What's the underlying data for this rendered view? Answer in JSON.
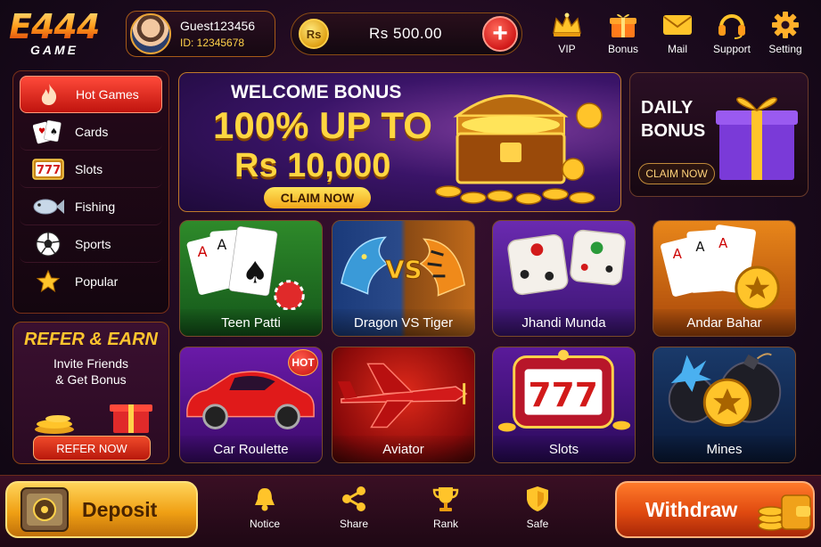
{
  "logo": {
    "main": "E444",
    "sub": "GAME"
  },
  "profile": {
    "name": "Guest123456",
    "id": "ID: 12345678"
  },
  "balance": {
    "currency_icon": "Rs",
    "amount": "Rs  500.00"
  },
  "top_icons": [
    {
      "label": "VIP",
      "icon": "crown-icon"
    },
    {
      "label": "Bonus",
      "icon": "gift-icon"
    },
    {
      "label": "Mail",
      "icon": "mail-icon"
    },
    {
      "label": "Support",
      "icon": "headset-icon"
    },
    {
      "label": "Setting",
      "icon": "gear-icon"
    }
  ],
  "sidebar": {
    "items": [
      {
        "label": "Hot Games",
        "icon": "flame-icon",
        "active": true
      },
      {
        "label": "Cards",
        "icon": "playing-cards-icon"
      },
      {
        "label": "Slots",
        "icon": "slot-777-icon"
      },
      {
        "label": "Fishing",
        "icon": "fish-icon"
      },
      {
        "label": "Sports",
        "icon": "soccer-ball-icon"
      },
      {
        "label": "Popular",
        "icon": "star-icon"
      }
    ]
  },
  "refer": {
    "title": "REFER & EARN",
    "line1": "Invite Friends",
    "line2": "& Get Bonus",
    "button": "REFER NOW"
  },
  "welcome_banner": {
    "line1": "WELCOME BONUS",
    "line2": "100% UP TO",
    "line3": "Rs 10,000",
    "button": "CLAIM NOW"
  },
  "daily_bonus": {
    "line1": "DAILY",
    "line2": "BONUS",
    "button": "CLAIM NOW"
  },
  "games": [
    {
      "name": "Teen Patti",
      "badge": ""
    },
    {
      "name": "Dragon VS Tiger",
      "badge": ""
    },
    {
      "name": "Jhandi Munda",
      "badge": ""
    },
    {
      "name": "Andar Bahar",
      "badge": ""
    },
    {
      "name": "Car Roulette",
      "badge": "HOT"
    },
    {
      "name": "Aviator",
      "badge": ""
    },
    {
      "name": "Slots",
      "badge": ""
    },
    {
      "name": "Mines",
      "badge": ""
    }
  ],
  "bottom": {
    "deposit": "Deposit",
    "withdraw": "Withdraw",
    "nav": [
      {
        "label": "Notice",
        "icon": "bell-icon"
      },
      {
        "label": "Share",
        "icon": "share-icon"
      },
      {
        "label": "Rank",
        "icon": "trophy-icon"
      },
      {
        "label": "Safe",
        "icon": "shield-icon"
      }
    ]
  },
  "colors": {
    "accent_gold": "#ffd640",
    "accent_red": "#d21a1a",
    "background": "#1c0a1e"
  }
}
